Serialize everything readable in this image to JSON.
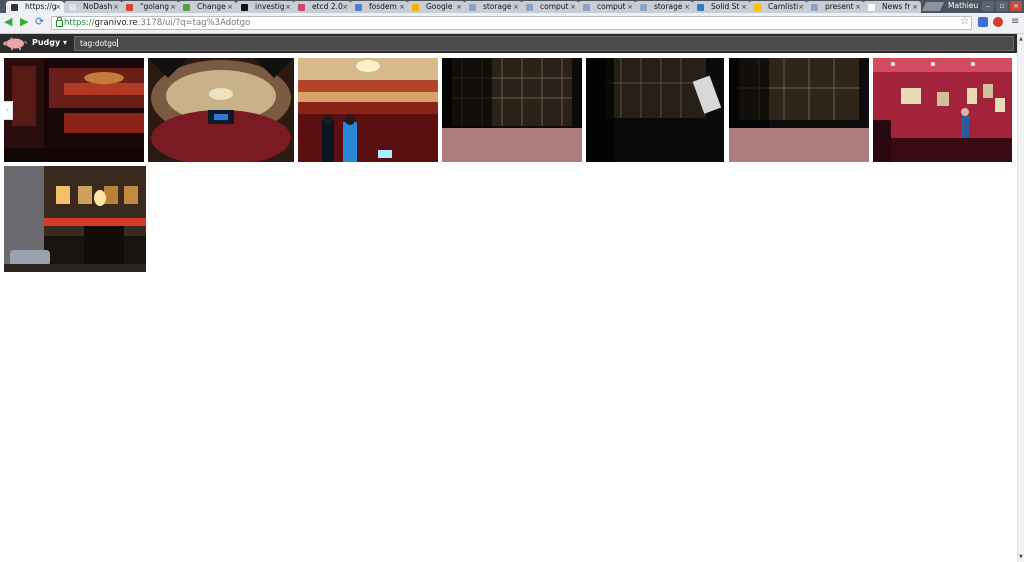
{
  "browser": {
    "tabs": [
      {
        "label": "https://g",
        "color": "#333333",
        "active": true
      },
      {
        "label": "NoDash",
        "color": "#e0e4ea"
      },
      {
        "label": "\"golang",
        "color": "#d44638"
      },
      {
        "label": "Change",
        "color": "#5aa13a"
      },
      {
        "label": "investig",
        "color": "#111111"
      },
      {
        "label": "etcd 2.0",
        "color": "#c84b6b"
      },
      {
        "label": "fosdem",
        "color": "#4a7fd6"
      },
      {
        "label": "Google",
        "color": "#f0b400"
      },
      {
        "label": "storage",
        "color": "#8da3c5"
      },
      {
        "label": "comput",
        "color": "#8da3c5"
      },
      {
        "label": "comput",
        "color": "#8da3c5"
      },
      {
        "label": "storage",
        "color": "#8da3c5"
      },
      {
        "label": "Solid St",
        "color": "#3b78c4"
      },
      {
        "label": "Camlisti",
        "color": "#f2c200"
      },
      {
        "label": "present",
        "color": "#8da3c5"
      },
      {
        "label": "News fr",
        "color": "#ffffff"
      }
    ],
    "profile_name": "Mathieu",
    "window_buttons": [
      "–",
      "▫",
      "×"
    ],
    "url": {
      "scheme": "https://",
      "host": "granivo.re",
      "rest": ":3178/ui/?q=tag%3Adotgo"
    }
  },
  "app": {
    "brand": "Pudgy ▾",
    "search_value": "tag:dotgo",
    "side_handle": "‹"
  },
  "icons": [
    "back-icon",
    "forward-icon",
    "reload-icon",
    "lock-icon",
    "star-icon",
    "extension-icon",
    "stop-extension-icon",
    "menu-icon",
    "pig-logo-icon",
    "close-icon"
  ],
  "colors": {
    "tabstrip": "#4a5460",
    "appbar": "#2b2b2b",
    "url_green": "#1e8a2e"
  },
  "photos": [
    {
      "name": "theatre-stage-box"
    },
    {
      "name": "theatre-auditorium-fisheye"
    },
    {
      "name": "theatre-audience-stage"
    },
    {
      "name": "stage-rigging-1"
    },
    {
      "name": "stage-rigging-2"
    },
    {
      "name": "stage-rigging-3"
    },
    {
      "name": "red-room-talk"
    },
    {
      "name": "street-night-facade"
    }
  ]
}
